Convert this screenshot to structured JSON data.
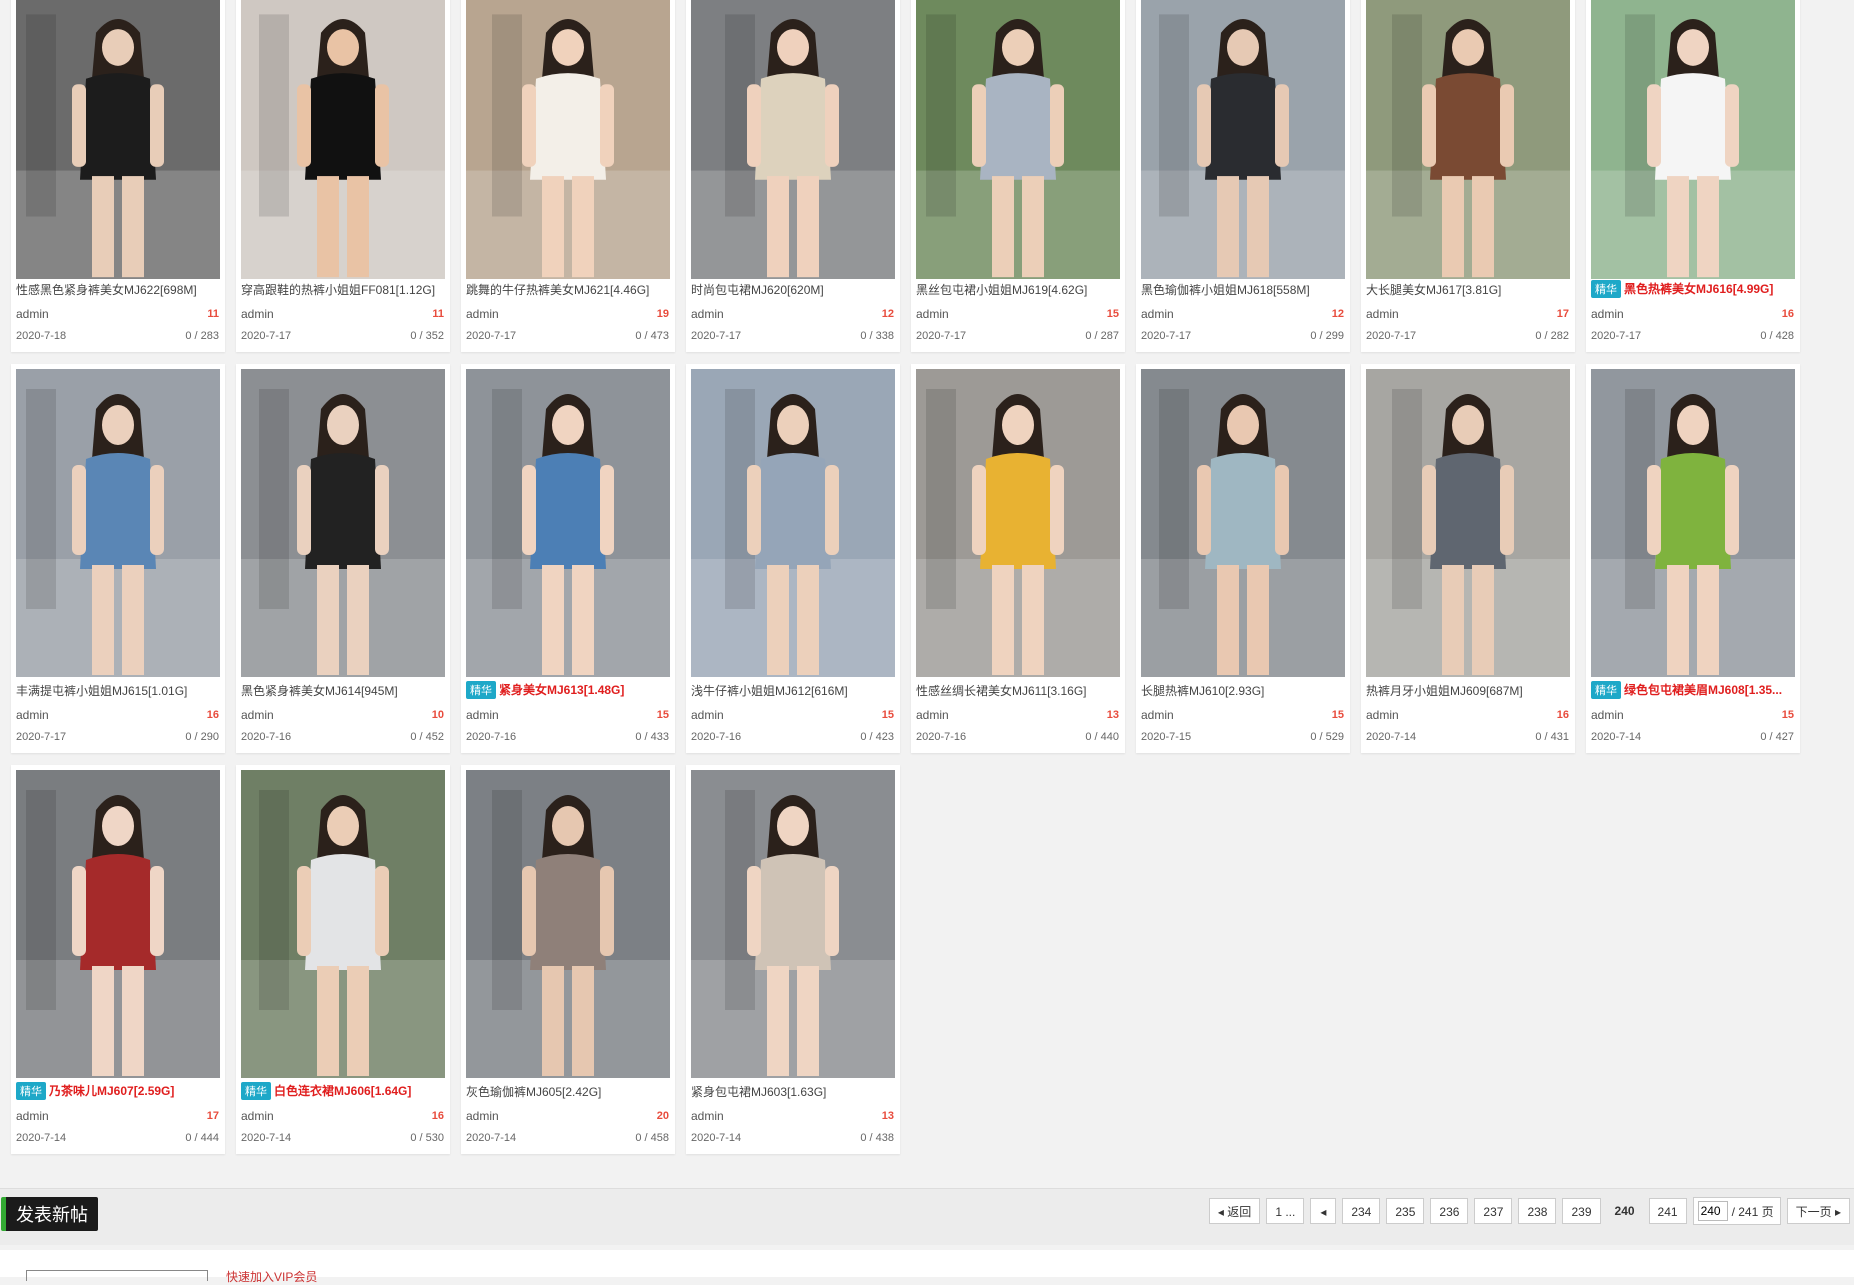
{
  "posts": [
    {
      "title": "性感黑色紧身裤美女MJ622[698M]",
      "author": "admin",
      "count": "11",
      "date": "2020-7-18",
      "stats": "0 / 283",
      "highlight": false,
      "bg": "#6b6b6b",
      "fg": "#1c1c1c",
      "skin": "#e8cdb8"
    },
    {
      "title": "穿高跟鞋的热裤小姐姐FF081[1.12G]",
      "author": "admin",
      "count": "11",
      "date": "2020-7-17",
      "stats": "0 / 352",
      "highlight": false,
      "bg": "#cfc8c2",
      "fg": "#111111",
      "skin": "#e9c3a5"
    },
    {
      "title": "跳舞的牛仔热裤美女MJ621[4.46G]",
      "author": "admin",
      "count": "19",
      "date": "2020-7-17",
      "stats": "0 / 473",
      "highlight": false,
      "bg": "#b8a590",
      "fg": "#f3efe8",
      "skin": "#f0d2bc"
    },
    {
      "title": "时尚包屯裙MJ620[620M]",
      "author": "admin",
      "count": "12",
      "date": "2020-7-17",
      "stats": "0 / 338",
      "highlight": false,
      "bg": "#7d7f82",
      "fg": "#ddd2bd",
      "skin": "#efd1bd"
    },
    {
      "title": "黑丝包屯裙小姐姐MJ619[4.62G]",
      "author": "admin",
      "count": "15",
      "date": "2020-7-17",
      "stats": "0 / 287",
      "highlight": false,
      "bg": "#6e8a5d",
      "fg": "#a9b4c2",
      "skin": "#eccfb8"
    },
    {
      "title": "黑色瑜伽裤小姐姐MJ618[558M]",
      "author": "admin",
      "count": "12",
      "date": "2020-7-17",
      "stats": "0 / 299",
      "highlight": false,
      "bg": "#9aa3ab",
      "fg": "#2a2c30",
      "skin": "#e6c9b4"
    },
    {
      "title": "大长腿美女MJ617[3.81G]",
      "author": "admin",
      "count": "17",
      "date": "2020-7-17",
      "stats": "0 / 282",
      "highlight": false,
      "bg": "#8f9a7c",
      "fg": "#7a4a33",
      "skin": "#eacab2"
    },
    {
      "title": "黑色热裤美女MJ616[4.99G]",
      "author": "admin",
      "count": "16",
      "date": "2020-7-17",
      "stats": "0 / 428",
      "highlight": true,
      "bg": "#8fb48f",
      "fg": "#f5f5f5",
      "skin": "#efd4c2"
    },
    {
      "title": "丰满提屯裤小姐姐MJ615[1.01G]",
      "author": "admin",
      "count": "16",
      "date": "2020-7-17",
      "stats": "0 / 290",
      "highlight": false,
      "bg": "#9aa0a8",
      "fg": "#5a86b5",
      "skin": "#ebd0bd"
    },
    {
      "title": "黑色紧身裤美女MJ614[945M]",
      "author": "admin",
      "count": "10",
      "date": "2020-7-16",
      "stats": "0 / 452",
      "highlight": false,
      "bg": "#8c8f93",
      "fg": "#222222",
      "skin": "#ead1bf"
    },
    {
      "title": "紧身美女MJ613[1.48G]",
      "author": "admin",
      "count": "15",
      "date": "2020-7-16",
      "stats": "0 / 433",
      "highlight": true,
      "bg": "#8e9399",
      "fg": "#4c7fb5",
      "skin": "#f0d4c1"
    },
    {
      "title": "浅牛仔裤小姐姐MJ612[616M]",
      "author": "admin",
      "count": "15",
      "date": "2020-7-16",
      "stats": "0 / 423",
      "highlight": false,
      "bg": "#9aa7b6",
      "fg": "#95a5b8",
      "skin": "#ecd0bb"
    },
    {
      "title": "性感丝绸长裙美女MJ611[3.16G]",
      "author": "admin",
      "count": "13",
      "date": "2020-7-16",
      "stats": "0 / 440",
      "highlight": false,
      "bg": "#9d9a96",
      "fg": "#e8b232",
      "skin": "#efd3bf"
    },
    {
      "title": "长腿热裤MJ610[2.93G]",
      "author": "admin",
      "count": "15",
      "date": "2020-7-15",
      "stats": "0 / 529",
      "highlight": false,
      "bg": "#858a8f",
      "fg": "#9fb7c2",
      "skin": "#e9c8b1"
    },
    {
      "title": "热裤月牙小姐姐MJ609[687M]",
      "author": "admin",
      "count": "16",
      "date": "2020-7-14",
      "stats": "0 / 431",
      "highlight": false,
      "bg": "#a7a6a2",
      "fg": "#5f6670",
      "skin": "#e8ccb7"
    },
    {
      "title": "绿色包屯裙美眉MJ608[1.35...",
      "author": "admin",
      "count": "15",
      "date": "2020-7-14",
      "stats": "0 / 427",
      "highlight": true,
      "bg": "#91979e",
      "fg": "#7fb33e",
      "skin": "#efd3c0"
    },
    {
      "title": "乃茶味儿MJ607[2.59G]",
      "author": "admin",
      "count": "17",
      "date": "2020-7-14",
      "stats": "0 / 444",
      "highlight": true,
      "bg": "#7a7d80",
      "fg": "#a52a2a",
      "skin": "#efd6c6"
    },
    {
      "title": "白色连衣裙MJ606[1.64G]",
      "author": "admin",
      "count": "16",
      "date": "2020-7-14",
      "stats": "0 / 530",
      "highlight": true,
      "bg": "#6f7f65",
      "fg": "#e3e4e6",
      "skin": "#ebcdb6"
    },
    {
      "title": "灰色瑜伽裤MJ605[2.42G]",
      "author": "admin",
      "count": "20",
      "date": "2020-7-14",
      "stats": "0 / 458",
      "highlight": false,
      "bg": "#7c8085",
      "fg": "#8f8079",
      "skin": "#e6c7b0"
    },
    {
      "title": "紧身包屯裙MJ603[1.63G]",
      "author": "admin",
      "count": "13",
      "date": "2020-7-14",
      "stats": "0 / 438",
      "highlight": false,
      "bg": "#8a8d91",
      "fg": "#cfc3b6",
      "skin": "#efd5c3"
    }
  ],
  "badge_label": "精华",
  "post_button": "发表新帖",
  "pager": {
    "back": "返回",
    "first": "1 ...",
    "prev_icon": "chevron-left",
    "pages": [
      "234",
      "235",
      "236",
      "237",
      "238",
      "239",
      "240",
      "241"
    ],
    "current": "240",
    "input_value": "240",
    "total": "/ 241 页",
    "next": "下一页"
  },
  "footer": {
    "link": "快速加入VIP会员"
  }
}
